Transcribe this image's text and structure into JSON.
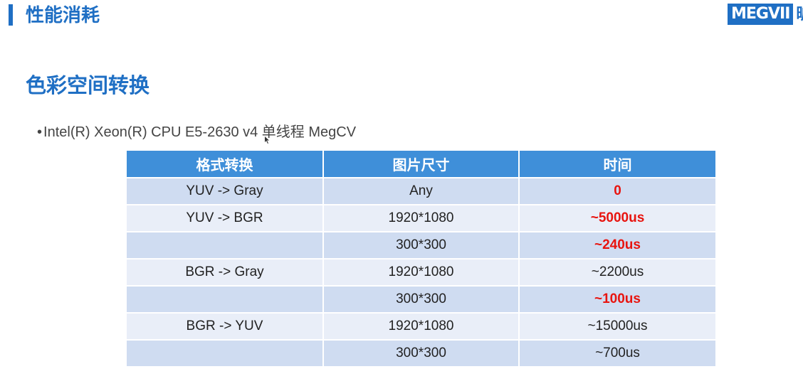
{
  "header": {
    "title": "性能消耗",
    "logo_text": "MEGVII",
    "logo_cn": "旷"
  },
  "section": {
    "title": "色彩空间转换"
  },
  "bullet": {
    "dot": "•",
    "text": "Intel(R) Xeon(R) CPU E5-2630 v4 单线程 MegCV"
  },
  "table": {
    "headers": [
      "格式转换",
      "图片尺寸",
      "时间"
    ],
    "rows": [
      {
        "format": "YUV -> Gray",
        "size": "Any",
        "time": "0",
        "highlight": true
      },
      {
        "format": "YUV -> BGR",
        "size": "1920*1080",
        "time": "~5000us",
        "highlight": true
      },
      {
        "format": "",
        "size": "300*300",
        "time": "~240us",
        "highlight": true
      },
      {
        "format": "BGR -> Gray",
        "size": "1920*1080",
        "time": "~2200us",
        "highlight": false
      },
      {
        "format": "",
        "size": "300*300",
        "time": "~100us",
        "highlight": true
      },
      {
        "format": "BGR -> YUV",
        "size": "1920*1080",
        "time": "~15000us",
        "highlight": false
      },
      {
        "format": "",
        "size": "300*300",
        "time": "~700us",
        "highlight": false
      }
    ]
  },
  "colors": {
    "brand_blue": "#1f6fc4",
    "header_blue": "#3f8fd9",
    "row_dark": "#cfdcf1",
    "row_light": "#e9eef8",
    "highlight_red": "#e8140f"
  }
}
